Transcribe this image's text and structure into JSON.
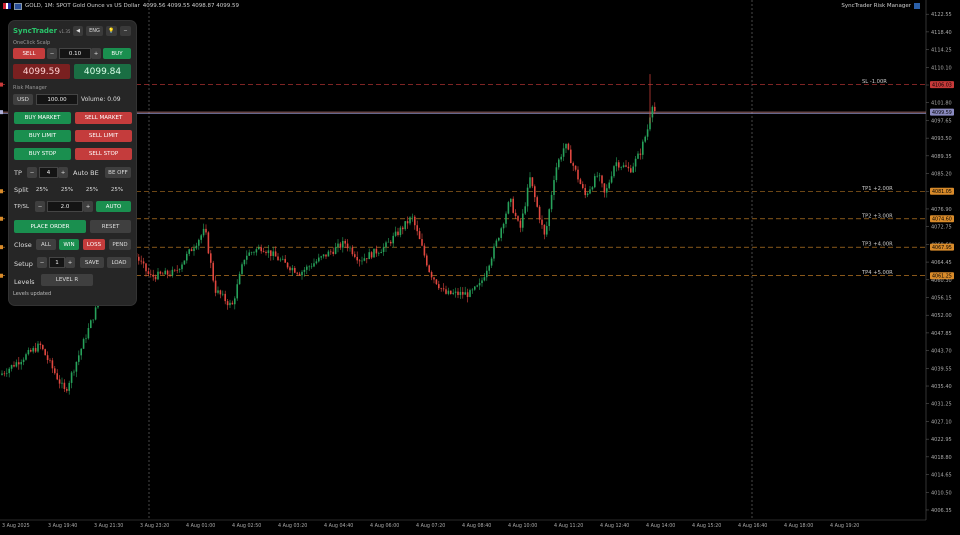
{
  "window": {
    "symbol_title": "GOLD, 1M: SPOT Gold Ounce vs US Dollar",
    "ohlc": "4099.56 4099.55 4098.87 4099.59",
    "indicator_title": "SyncTrader Risk Manager"
  },
  "chart_data": {
    "type": "candlestick",
    "y_ticks": [
      "4122.55",
      "4118.40",
      "4114.25",
      "4110.10",
      "4105.95",
      "4101.80",
      "4097.65",
      "4093.50",
      "4089.35",
      "4085.20",
      "4081.05",
      "4076.90",
      "4072.75",
      "4068.60",
      "4064.45",
      "4060.30",
      "4056.15",
      "4052.00",
      "4047.85",
      "4043.70",
      "4039.55",
      "4035.40",
      "4031.25",
      "4027.10",
      "4022.95",
      "4018.80",
      "4014.65",
      "4010.50",
      "4006.35"
    ],
    "x_ticks": [
      "3 Aug 2025",
      "3 Aug 19:40",
      "3 Aug 21:30",
      "3 Aug 23:20",
      "4 Aug 01:00",
      "4 Aug 02:50",
      "4 Aug 03:20",
      "4 Aug 04:40",
      "4 Aug 06:00",
      "4 Aug 07:20",
      "4 Aug 08:40",
      "4 Aug 10:00",
      "4 Aug 11:20",
      "4 Aug 12:40",
      "4 Aug 14:00",
      "4 Aug 15:20",
      "4 Aug 16:40",
      "4 Aug 18:00",
      "4 Aug 19:20"
    ],
    "ylim": [
      4004.0,
      4124.0
    ],
    "levels": [
      {
        "name": "SL",
        "label": "SL  -1.00R",
        "price": 4106.05,
        "tag": "4106.03",
        "color": "#c93a3a"
      },
      {
        "name": "Entry",
        "label": "",
        "price": 4099.59,
        "tag": "4099.59",
        "color": "#b0b0d8"
      },
      {
        "name": "TP1",
        "label": "TP1  +2.00R",
        "price": 4081.05,
        "tag": "4081.05",
        "color": "#d98b2a"
      },
      {
        "name": "TP2",
        "label": "TP2  +3.00R",
        "price": 4074.6,
        "tag": "4074.60",
        "color": "#d98b2a"
      },
      {
        "name": "TP3",
        "label": "TP3  +4.00R",
        "price": 4067.95,
        "tag": "4067.95",
        "color": "#d98b2a"
      },
      {
        "name": "TP4",
        "label": "TP4  +5.00R",
        "price": 4061.25,
        "tag": "4061.25",
        "color": "#d98b2a"
      }
    ],
    "current_price": "4099.59",
    "up_color": "#27a25b",
    "down_color": "#e0473f",
    "key_points": [
      [
        0,
        4038
      ],
      [
        40,
        4045
      ],
      [
        65,
        4034
      ],
      [
        100,
        4056
      ],
      [
        130,
        4068
      ],
      [
        150,
        4061
      ],
      [
        175,
        4062
      ],
      [
        205,
        4072
      ],
      [
        215,
        4058
      ],
      [
        232,
        4054
      ],
      [
        245,
        4066
      ],
      [
        262,
        4068
      ],
      [
        285,
        4064
      ],
      [
        300,
        4062
      ],
      [
        325,
        4066
      ],
      [
        345,
        4069
      ],
      [
        360,
        4065
      ],
      [
        385,
        4068
      ],
      [
        412,
        4075
      ],
      [
        430,
        4062
      ],
      [
        445,
        4057
      ],
      [
        470,
        4057
      ],
      [
        480,
        4059
      ],
      [
        495,
        4068
      ],
      [
        510,
        4079
      ],
      [
        520,
        4072
      ],
      [
        530,
        4084
      ],
      [
        545,
        4070
      ],
      [
        555,
        4086
      ],
      [
        565,
        4092
      ],
      [
        575,
        4086
      ],
      [
        585,
        4080
      ],
      [
        598,
        4085
      ],
      [
        605,
        4080
      ],
      [
        615,
        4088
      ],
      [
        630,
        4086
      ],
      [
        640,
        4090
      ],
      [
        648,
        4096
      ],
      [
        652,
        4102
      ],
      [
        656,
        4099
      ]
    ]
  },
  "panel": {
    "title": "SyncTrader",
    "version": "v1.35",
    "top_buttons": [
      "◀",
      "ENG",
      "💡",
      "−"
    ],
    "oneclick_label": "OneClick Scalp",
    "sell_label": "SELL",
    "minus": "−",
    "plus": "+",
    "lot_value": "0.10",
    "buy_label": "BUY",
    "bid": "4099.59",
    "ask": "4099.84",
    "risk_label": "Risk Manager",
    "currency": "USD",
    "risk_value": "100.00",
    "volume_label": "Volume: 0.09",
    "buy_market": "BUY MARKET",
    "sell_market": "SELL MARKET",
    "buy_limit": "BUY LIMIT",
    "sell_limit": "SELL LIMIT",
    "buy_stop": "BUY STOP",
    "sell_stop": "SELL STOP",
    "tp_label": "TP",
    "tp_value": "4",
    "auto_be_label": "Auto BE",
    "be_off": "BE OFF",
    "split_label": "Split",
    "splits": [
      "25%",
      "25%",
      "25%",
      "25%"
    ],
    "tpsl_label": "TP/SL",
    "tpsl_value": "2.0",
    "auto_label": "AUTO",
    "place_order": "PLACE ORDER",
    "reset": "RESET",
    "close_label": "Close",
    "close_all": "ALL",
    "close_win": "WIN",
    "close_loss": "LOSS",
    "close_pend": "PEND",
    "setup_label": "Setup",
    "setup_value": "1",
    "save": "SAVE",
    "load": "LOAD",
    "levels_label": "Levels",
    "level_r": "LEVEL R",
    "status": "Levels updated"
  }
}
